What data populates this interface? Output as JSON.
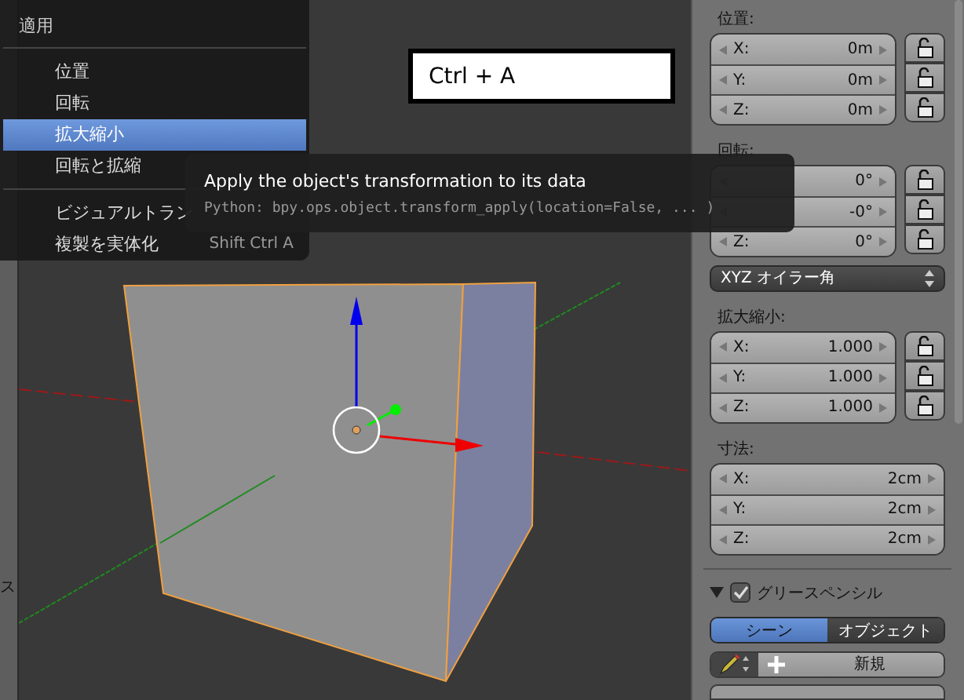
{
  "viewport": {
    "shortcut_hint": "Ctrl + A",
    "left_toolbar_text": "ス"
  },
  "menu": {
    "title": "適用",
    "groups": [
      [
        {
          "label": "位置",
          "selected": false
        },
        {
          "label": "回転",
          "selected": false
        },
        {
          "label": "拡大縮小",
          "selected": true
        },
        {
          "label": "回転と拡縮",
          "selected": false
        }
      ],
      [
        {
          "label": "ビジュアルトラン",
          "selected": false
        },
        {
          "label": "複製を実体化",
          "selected": false,
          "shortcut": "Shift Ctrl A"
        }
      ]
    ]
  },
  "tooltip": {
    "description": "Apply the object's transformation to its data",
    "python": "Python: bpy.ops.object.transform_apply(location=False, ... )"
  },
  "properties": {
    "sections": [
      {
        "title": "位置:",
        "rows": [
          {
            "axis": "X:",
            "value": "0m",
            "locked": false
          },
          {
            "axis": "Y:",
            "value": "0m",
            "locked": false
          },
          {
            "axis": "Z:",
            "value": "0m",
            "locked": false
          }
        ]
      },
      {
        "title": "回転:",
        "rows": [
          {
            "value": "0°",
            "locked": false
          },
          {
            "value": "-0°",
            "locked": false
          },
          {
            "axis": "Z:",
            "value": "0°",
            "locked": false
          }
        ],
        "mode": "XYZ オイラー角"
      },
      {
        "title": "拡大縮小:",
        "rows": [
          {
            "axis": "X:",
            "value": "1.000",
            "locked": false
          },
          {
            "axis": "Y:",
            "value": "1.000",
            "locked": false
          },
          {
            "axis": "Z:",
            "value": "1.000",
            "locked": false
          }
        ]
      },
      {
        "title": "寸法:",
        "rows": [
          {
            "axis": "X:",
            "value": "2cm"
          },
          {
            "axis": "Y:",
            "value": "2cm"
          },
          {
            "axis": "Z:",
            "value": "2cm"
          }
        ]
      }
    ],
    "grease_pencil": {
      "title": "グリースペンシル",
      "expanded": true,
      "checked": true,
      "tabs": [
        {
          "label": "シーン",
          "selected": true
        },
        {
          "label": "オブジェクト",
          "selected": false
        }
      ],
      "new_button": "新規"
    }
  }
}
